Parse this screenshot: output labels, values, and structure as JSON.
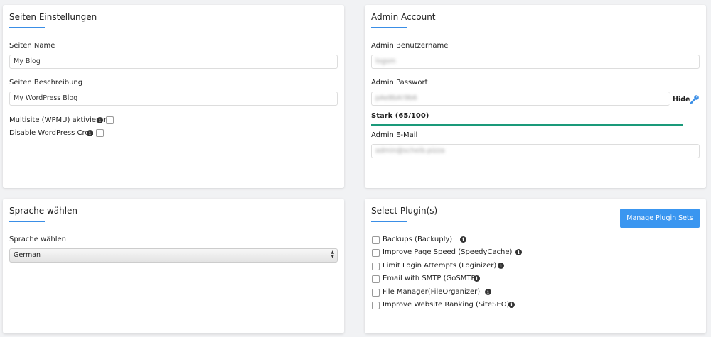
{
  "site_settings": {
    "title": "Seiten Einstellungen",
    "site_name_label": "Seiten Name",
    "site_name_value": "My Blog",
    "site_desc_label": "Seiten Beschreibung",
    "site_desc_value": "My WordPress Blog",
    "multisite_label": "Multisite (WPMU) aktivieren",
    "cron_label": "Disable WordPress Cron"
  },
  "admin": {
    "title": "Admin Account",
    "username_label": "Admin Benutzername",
    "username_value": "logsm",
    "password_label": "Admin Passwort",
    "password_value": "pAe8bA!9b6",
    "hide_label": "Hide",
    "strength_text": "Stark (65/100)",
    "strength_percent": 100,
    "strength_color": "#1a9a7a",
    "email_label": "Admin E-Mail",
    "email_value": "admin@scheib.pizza"
  },
  "language": {
    "title": "Sprache wählen",
    "label": "Sprache wählen",
    "selected": "German"
  },
  "plugins": {
    "title": "Select Plugin(s)",
    "manage_button": "Manage Plugin Sets",
    "items": [
      {
        "label": "Backups (Backuply)"
      },
      {
        "label": "Improve Page Speed (SpeedyCache)"
      },
      {
        "label": "Limit Login Attempts (Loginizer)"
      },
      {
        "label": "Email with SMTP (GoSMTP)"
      },
      {
        "label": "File Manager(FileOrganizer)"
      },
      {
        "label": "Improve Website Ranking (SiteSEO)"
      }
    ]
  },
  "colors": {
    "accent": "#3a8ee6",
    "button": "#3a96f0"
  }
}
